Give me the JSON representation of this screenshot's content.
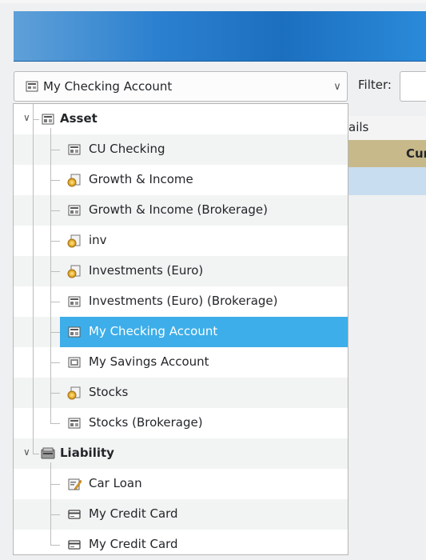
{
  "account_selector": {
    "selected": "My Checking Account",
    "icon": "checking-icon"
  },
  "filter": {
    "label": "Filter:",
    "value": ""
  },
  "background": {
    "header_fragment": "ails",
    "gold_header_fragment": "Cur"
  },
  "tree": {
    "categories": [
      {
        "label": "Asset",
        "icon": "asset-icon",
        "expanded": true,
        "items": [
          {
            "label": "CU Checking",
            "icon": "checking-icon"
          },
          {
            "label": "Growth & Income",
            "icon": "investment-icon"
          },
          {
            "label": "Growth & Income (Brokerage)",
            "icon": "checking-icon"
          },
          {
            "label": "inv",
            "icon": "investment-icon"
          },
          {
            "label": "Investments (Euro)",
            "icon": "investment-icon"
          },
          {
            "label": "Investments (Euro) (Brokerage)",
            "icon": "checking-icon"
          },
          {
            "label": "My Checking Account",
            "icon": "checking-icon",
            "selected": true
          },
          {
            "label": "My Savings Account",
            "icon": "savings-icon"
          },
          {
            "label": "Stocks",
            "icon": "investment-icon"
          },
          {
            "label": "Stocks (Brokerage)",
            "icon": "checking-icon"
          }
        ]
      },
      {
        "label": "Liability",
        "icon": "liability-icon",
        "expanded": true,
        "items": [
          {
            "label": "Car Loan",
            "icon": "loan-icon"
          },
          {
            "label": "My Credit Card",
            "icon": "credit-card-icon"
          },
          {
            "label": "My Credit Card",
            "icon": "credit-card-icon"
          }
        ]
      }
    ]
  },
  "colors": {
    "selection": "#3daee9",
    "banner": "#2b80cf",
    "gold": "#c8b98b"
  }
}
